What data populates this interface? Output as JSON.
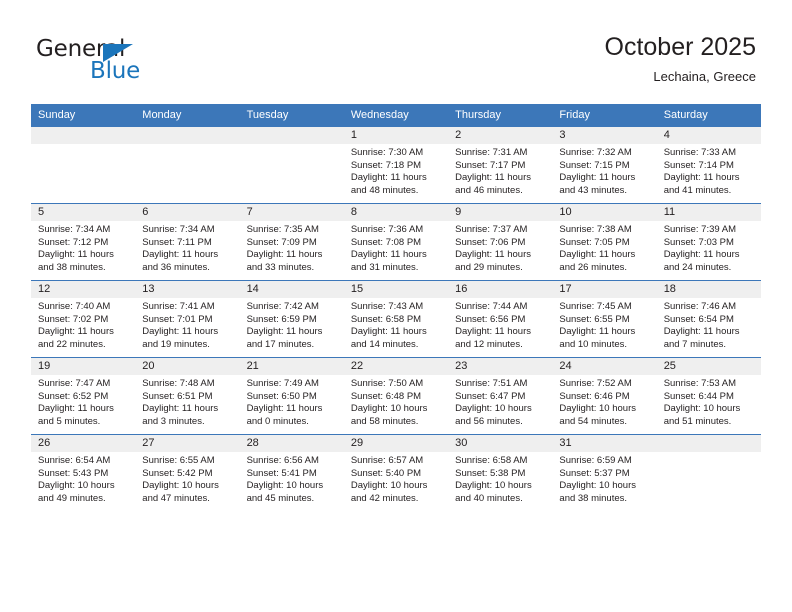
{
  "brand": {
    "name_top": "General",
    "name_bottom": "Blue",
    "flag_color": "#1b75bb"
  },
  "header": {
    "title": "October 2025",
    "location": "Lechaina, Greece"
  },
  "theme": {
    "header_bg": "#3c77b9",
    "daynum_bg": "#efefef",
    "grid_line": "#3c77b9",
    "text": "#231f20"
  },
  "weekday_headers": [
    "Sunday",
    "Monday",
    "Tuesday",
    "Wednesday",
    "Thursday",
    "Friday",
    "Saturday"
  ],
  "labels": {
    "sunrise_prefix": "Sunrise:",
    "sunset_prefix": "Sunset:",
    "daylight_prefix": "Daylight:"
  },
  "weeks": [
    [
      {
        "day": "",
        "line1": "",
        "line2": "",
        "line3": "",
        "line4": "",
        "empty": true
      },
      {
        "day": "",
        "line1": "",
        "line2": "",
        "line3": "",
        "line4": "",
        "empty": true
      },
      {
        "day": "",
        "line1": "",
        "line2": "",
        "line3": "",
        "line4": "",
        "empty": true
      },
      {
        "day": "1",
        "line1": "Sunrise: 7:30 AM",
        "line2": "Sunset: 7:18 PM",
        "line3": "Daylight: 11 hours",
        "line4": "and 48 minutes.",
        "empty": false
      },
      {
        "day": "2",
        "line1": "Sunrise: 7:31 AM",
        "line2": "Sunset: 7:17 PM",
        "line3": "Daylight: 11 hours",
        "line4": "and 46 minutes.",
        "empty": false
      },
      {
        "day": "3",
        "line1": "Sunrise: 7:32 AM",
        "line2": "Sunset: 7:15 PM",
        "line3": "Daylight: 11 hours",
        "line4": "and 43 minutes.",
        "empty": false
      },
      {
        "day": "4",
        "line1": "Sunrise: 7:33 AM",
        "line2": "Sunset: 7:14 PM",
        "line3": "Daylight: 11 hours",
        "line4": "and 41 minutes.",
        "empty": false
      }
    ],
    [
      {
        "day": "5",
        "line1": "Sunrise: 7:34 AM",
        "line2": "Sunset: 7:12 PM",
        "line3": "Daylight: 11 hours",
        "line4": "and 38 minutes.",
        "empty": false
      },
      {
        "day": "6",
        "line1": "Sunrise: 7:34 AM",
        "line2": "Sunset: 7:11 PM",
        "line3": "Daylight: 11 hours",
        "line4": "and 36 minutes.",
        "empty": false
      },
      {
        "day": "7",
        "line1": "Sunrise: 7:35 AM",
        "line2": "Sunset: 7:09 PM",
        "line3": "Daylight: 11 hours",
        "line4": "and 33 minutes.",
        "empty": false
      },
      {
        "day": "8",
        "line1": "Sunrise: 7:36 AM",
        "line2": "Sunset: 7:08 PM",
        "line3": "Daylight: 11 hours",
        "line4": "and 31 minutes.",
        "empty": false
      },
      {
        "day": "9",
        "line1": "Sunrise: 7:37 AM",
        "line2": "Sunset: 7:06 PM",
        "line3": "Daylight: 11 hours",
        "line4": "and 29 minutes.",
        "empty": false
      },
      {
        "day": "10",
        "line1": "Sunrise: 7:38 AM",
        "line2": "Sunset: 7:05 PM",
        "line3": "Daylight: 11 hours",
        "line4": "and 26 minutes.",
        "empty": false
      },
      {
        "day": "11",
        "line1": "Sunrise: 7:39 AM",
        "line2": "Sunset: 7:03 PM",
        "line3": "Daylight: 11 hours",
        "line4": "and 24 minutes.",
        "empty": false
      }
    ],
    [
      {
        "day": "12",
        "line1": "Sunrise: 7:40 AM",
        "line2": "Sunset: 7:02 PM",
        "line3": "Daylight: 11 hours",
        "line4": "and 22 minutes.",
        "empty": false
      },
      {
        "day": "13",
        "line1": "Sunrise: 7:41 AM",
        "line2": "Sunset: 7:01 PM",
        "line3": "Daylight: 11 hours",
        "line4": "and 19 minutes.",
        "empty": false
      },
      {
        "day": "14",
        "line1": "Sunrise: 7:42 AM",
        "line2": "Sunset: 6:59 PM",
        "line3": "Daylight: 11 hours",
        "line4": "and 17 minutes.",
        "empty": false
      },
      {
        "day": "15",
        "line1": "Sunrise: 7:43 AM",
        "line2": "Sunset: 6:58 PM",
        "line3": "Daylight: 11 hours",
        "line4": "and 14 minutes.",
        "empty": false
      },
      {
        "day": "16",
        "line1": "Sunrise: 7:44 AM",
        "line2": "Sunset: 6:56 PM",
        "line3": "Daylight: 11 hours",
        "line4": "and 12 minutes.",
        "empty": false
      },
      {
        "day": "17",
        "line1": "Sunrise: 7:45 AM",
        "line2": "Sunset: 6:55 PM",
        "line3": "Daylight: 11 hours",
        "line4": "and 10 minutes.",
        "empty": false
      },
      {
        "day": "18",
        "line1": "Sunrise: 7:46 AM",
        "line2": "Sunset: 6:54 PM",
        "line3": "Daylight: 11 hours",
        "line4": "and 7 minutes.",
        "empty": false
      }
    ],
    [
      {
        "day": "19",
        "line1": "Sunrise: 7:47 AM",
        "line2": "Sunset: 6:52 PM",
        "line3": "Daylight: 11 hours",
        "line4": "and 5 minutes.",
        "empty": false
      },
      {
        "day": "20",
        "line1": "Sunrise: 7:48 AM",
        "line2": "Sunset: 6:51 PM",
        "line3": "Daylight: 11 hours",
        "line4": "and 3 minutes.",
        "empty": false
      },
      {
        "day": "21",
        "line1": "Sunrise: 7:49 AM",
        "line2": "Sunset: 6:50 PM",
        "line3": "Daylight: 11 hours",
        "line4": "and 0 minutes.",
        "empty": false
      },
      {
        "day": "22",
        "line1": "Sunrise: 7:50 AM",
        "line2": "Sunset: 6:48 PM",
        "line3": "Daylight: 10 hours",
        "line4": "and 58 minutes.",
        "empty": false
      },
      {
        "day": "23",
        "line1": "Sunrise: 7:51 AM",
        "line2": "Sunset: 6:47 PM",
        "line3": "Daylight: 10 hours",
        "line4": "and 56 minutes.",
        "empty": false
      },
      {
        "day": "24",
        "line1": "Sunrise: 7:52 AM",
        "line2": "Sunset: 6:46 PM",
        "line3": "Daylight: 10 hours",
        "line4": "and 54 minutes.",
        "empty": false
      },
      {
        "day": "25",
        "line1": "Sunrise: 7:53 AM",
        "line2": "Sunset: 6:44 PM",
        "line3": "Daylight: 10 hours",
        "line4": "and 51 minutes.",
        "empty": false
      }
    ],
    [
      {
        "day": "26",
        "line1": "Sunrise: 6:54 AM",
        "line2": "Sunset: 5:43 PM",
        "line3": "Daylight: 10 hours",
        "line4": "and 49 minutes.",
        "empty": false
      },
      {
        "day": "27",
        "line1": "Sunrise: 6:55 AM",
        "line2": "Sunset: 5:42 PM",
        "line3": "Daylight: 10 hours",
        "line4": "and 47 minutes.",
        "empty": false
      },
      {
        "day": "28",
        "line1": "Sunrise: 6:56 AM",
        "line2": "Sunset: 5:41 PM",
        "line3": "Daylight: 10 hours",
        "line4": "and 45 minutes.",
        "empty": false
      },
      {
        "day": "29",
        "line1": "Sunrise: 6:57 AM",
        "line2": "Sunset: 5:40 PM",
        "line3": "Daylight: 10 hours",
        "line4": "and 42 minutes.",
        "empty": false
      },
      {
        "day": "30",
        "line1": "Sunrise: 6:58 AM",
        "line2": "Sunset: 5:38 PM",
        "line3": "Daylight: 10 hours",
        "line4": "and 40 minutes.",
        "empty": false
      },
      {
        "day": "31",
        "line1": "Sunrise: 6:59 AM",
        "line2": "Sunset: 5:37 PM",
        "line3": "Daylight: 10 hours",
        "line4": "and 38 minutes.",
        "empty": false
      },
      {
        "day": "",
        "line1": "",
        "line2": "",
        "line3": "",
        "line4": "",
        "empty": true
      }
    ]
  ]
}
